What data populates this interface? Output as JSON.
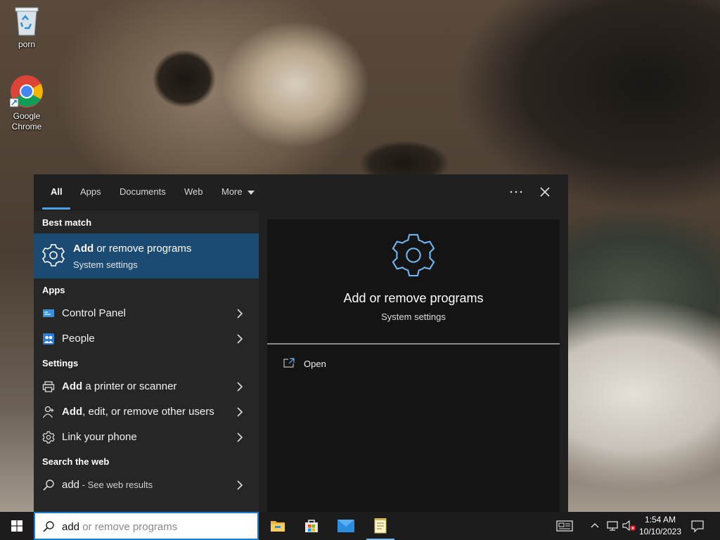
{
  "desktop": {
    "icons": [
      {
        "label": "porn",
        "icon": "recycle-bin-icon"
      },
      {
        "label": "Google Chrome",
        "icon": "chrome-icon"
      }
    ]
  },
  "search_panel": {
    "tabs": [
      "All",
      "Apps",
      "Documents",
      "Web",
      "More"
    ],
    "active_tab": "All",
    "accent_color": "#4aa3ea",
    "best_match_section": "Best match",
    "best_match": {
      "title_bold": "Add",
      "title_rest": " or remove programs",
      "subtitle": "System settings",
      "icon": "gear-icon"
    },
    "apps_section": "Apps",
    "apps": [
      {
        "label": "Control Panel",
        "icon": "control-panel-icon"
      },
      {
        "label": "People",
        "icon": "people-icon"
      }
    ],
    "settings_section": "Settings",
    "settings": [
      {
        "label_bold": "Add",
        "label_rest": " a printer or scanner",
        "icon": "printer-icon"
      },
      {
        "label_bold": "Add",
        "label_rest": ", edit, or remove other users",
        "icon": "person-icon"
      },
      {
        "label_bold": "",
        "label_rest": "Link your phone",
        "icon": "gear-icon"
      }
    ],
    "web_section": "Search the web",
    "web_result": {
      "query": "add",
      "suffix": " - See web results",
      "icon": "search-icon"
    },
    "detail": {
      "title": "Add or remove programs",
      "subtitle": "System settings",
      "actions": [
        {
          "label": "Open",
          "icon": "open-icon"
        }
      ]
    }
  },
  "taskbar": {
    "search": {
      "typed": "add",
      "suggestion": " or remove programs"
    },
    "apps": [
      "file-explorer-icon",
      "microsoft-store-icon",
      "mail-icon",
      "notepad-icon"
    ],
    "clock": {
      "time": "1:54 AM",
      "date": "10/10/2023"
    }
  }
}
